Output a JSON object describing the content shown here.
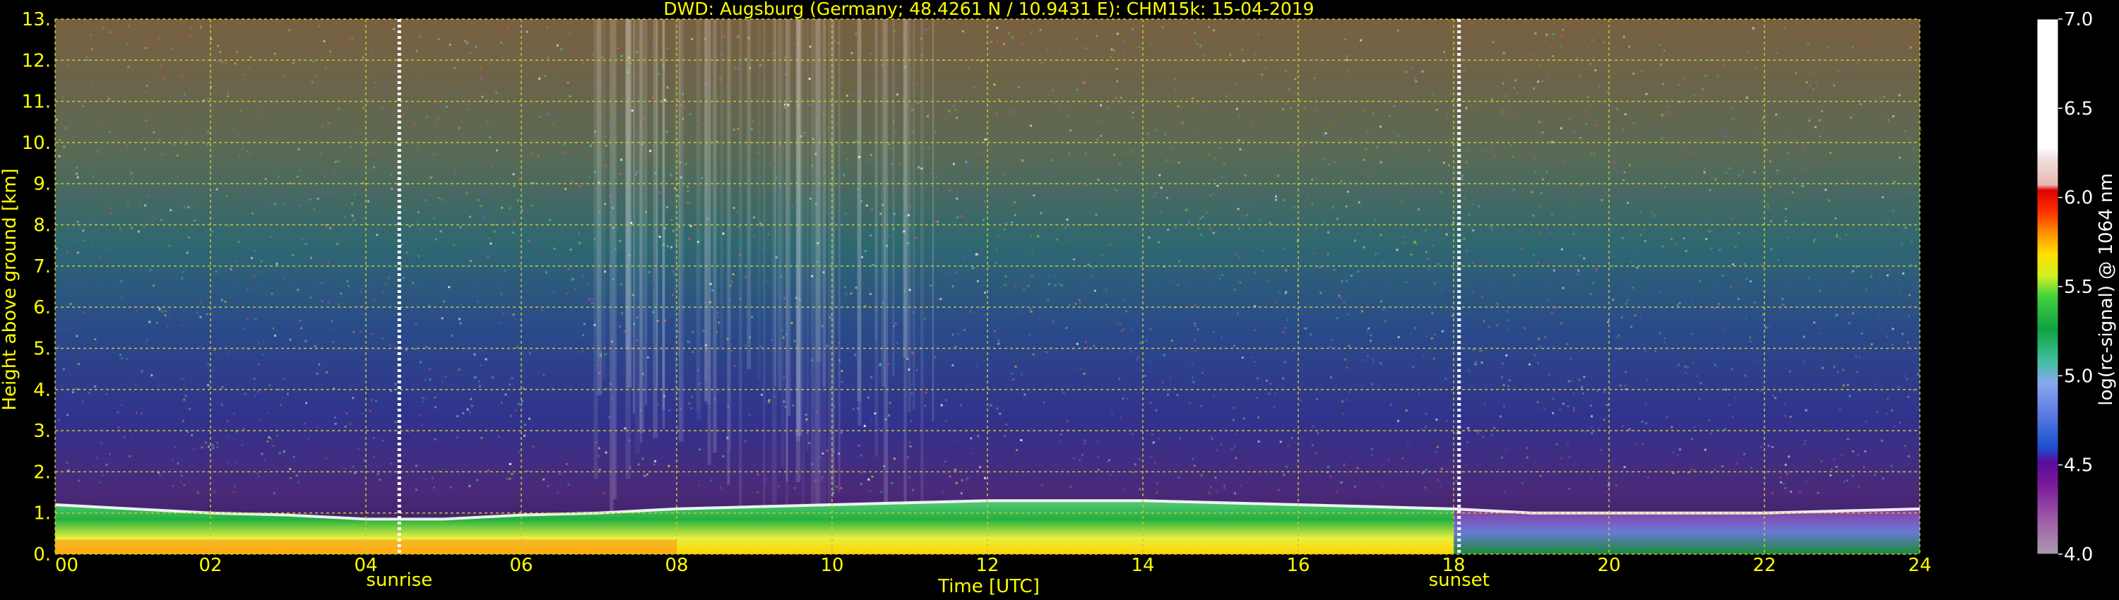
{
  "chart_data": {
    "type": "heatmap",
    "title": "DWD: Augsburg (Germany; 48.4261 N / 10.9431 E):    CHM15k: 15-04-2019",
    "xlabel": "Time [UTC]",
    "ylabel": "Height above ground [km]",
    "xlim": [
      0,
      24
    ],
    "ylim": [
      0,
      13
    ],
    "xticks": [
      "00",
      "02",
      "04",
      "06",
      "08",
      "10",
      "12",
      "14",
      "16",
      "18",
      "20",
      "22",
      "24"
    ],
    "yticks": [
      "0.",
      "1.",
      "2.",
      "3.",
      "4.",
      "5.",
      "6.",
      "7.",
      "8.",
      "9.",
      "10.",
      "11.",
      "12.",
      "13."
    ],
    "grid": true,
    "annotations": [
      {
        "label": "sunrise",
        "x": 4.43
      },
      {
        "label": "sunset",
        "x": 18.07
      }
    ],
    "colorbar": {
      "label": "log(rc-signal) @ 1064 nm",
      "range": [
        4.0,
        7.0
      ],
      "ticks": [
        "4.0",
        "4.5",
        "5.0",
        "5.5",
        "6.0",
        "6.5",
        "7.0"
      ]
    },
    "boundary_layer": {
      "x": [
        0,
        1,
        2,
        3,
        4,
        5,
        6,
        7,
        8,
        9,
        10,
        11,
        12,
        13,
        14,
        15,
        16,
        17,
        18,
        19,
        20,
        21,
        22,
        23,
        24
      ],
      "y": [
        1.2,
        1.1,
        1.0,
        0.95,
        0.85,
        0.85,
        0.95,
        1.0,
        1.1,
        1.15,
        1.2,
        1.25,
        1.3,
        1.3,
        1.3,
        1.25,
        1.2,
        1.15,
        1.1,
        1.0,
        1.0,
        1.0,
        1.0,
        1.05,
        1.1
      ]
    }
  },
  "colors": {
    "background": "#000000",
    "text": "#ffff00",
    "grid": "#c8c832",
    "marker": "#ffffff",
    "colorbar_text": "#ffffff"
  }
}
